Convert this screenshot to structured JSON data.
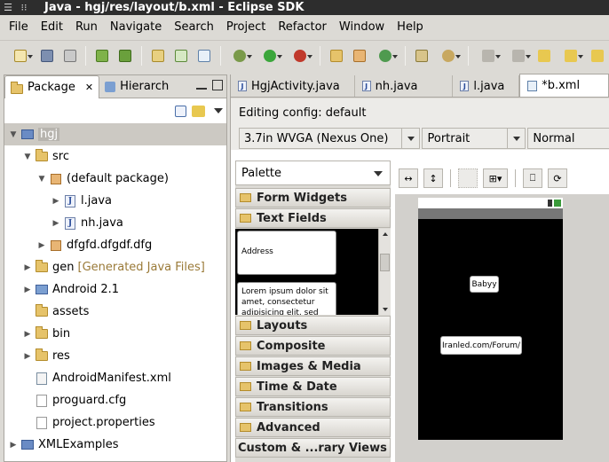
{
  "window": {
    "title": "Java - hgj/res/layout/b.xml - Eclipse SDK"
  },
  "menu": [
    "File",
    "Edit",
    "Run",
    "Navigate",
    "Search",
    "Project",
    "Refactor",
    "Window",
    "Help"
  ],
  "left_panel": {
    "tabs": [
      {
        "label": "Package",
        "active": true
      },
      {
        "label": "Hierarch",
        "active": false
      }
    ],
    "tree": [
      {
        "label": "hgj",
        "level": 0,
        "expanded": true,
        "icon": "project-icon",
        "selected": true
      },
      {
        "label": "src",
        "level": 1,
        "expanded": true,
        "icon": "source-folder-icon"
      },
      {
        "label": "(default package)",
        "level": 2,
        "expanded": true,
        "icon": "package-icon"
      },
      {
        "label": "l.java",
        "level": 3,
        "expanded": false,
        "icon": "java-file-icon"
      },
      {
        "label": "nh.java",
        "level": 3,
        "expanded": false,
        "icon": "java-file-icon"
      },
      {
        "label": "dfgfd.dfgdf.dfg",
        "level": 2,
        "expanded": false,
        "icon": "package-icon"
      },
      {
        "label": "gen",
        "suffix": "[Generated Java Files]",
        "level": 1,
        "expanded": false,
        "icon": "source-folder-icon"
      },
      {
        "label": "Android 2.1",
        "level": 1,
        "expanded": false,
        "icon": "library-icon"
      },
      {
        "label": "assets",
        "level": 1,
        "expanded": null,
        "icon": "folder-icon"
      },
      {
        "label": "bin",
        "level": 1,
        "expanded": false,
        "icon": "folder-icon"
      },
      {
        "label": "res",
        "level": 1,
        "expanded": false,
        "icon": "folder-icon"
      },
      {
        "label": "AndroidManifest.xml",
        "level": 1,
        "expanded": null,
        "icon": "xml-file-icon"
      },
      {
        "label": "proguard.cfg",
        "level": 1,
        "expanded": null,
        "icon": "text-file-icon"
      },
      {
        "label": "project.properties",
        "level": 1,
        "expanded": null,
        "icon": "text-file-icon"
      },
      {
        "label": "XMLExamples",
        "level": 0,
        "expanded": false,
        "icon": "project-icon"
      }
    ]
  },
  "editor": {
    "tabs": [
      {
        "label": "HgjActivity.java",
        "active": false,
        "icon": "java-file-icon"
      },
      {
        "label": "nh.java",
        "active": false,
        "icon": "java-file-icon"
      },
      {
        "label": "l.java",
        "active": false,
        "icon": "java-file-icon"
      },
      {
        "label": "*b.xml",
        "active": true,
        "icon": "android-layout-icon"
      }
    ],
    "config_text": "Editing config: default",
    "device_combo": "3.7in WVGA (Nexus One)",
    "orientation_combo": "Portrait",
    "theme_combo": "Normal",
    "palette": {
      "title": "Palette",
      "categories": [
        "Form Widgets",
        "Text Fields",
        "Layouts",
        "Composite",
        "Images & Media",
        "Time & Date",
        "Transitions",
        "Advanced",
        "Custom & ...rary Views"
      ],
      "expanded": "Text Fields",
      "text_field_items": [
        "Address",
        "Lorem ipsum dolor sit amet, consectetur adipisicing elit, sed"
      ]
    },
    "preview": {
      "buttons": [
        "Babyy",
        "Iranled.com/Forum/"
      ]
    }
  }
}
